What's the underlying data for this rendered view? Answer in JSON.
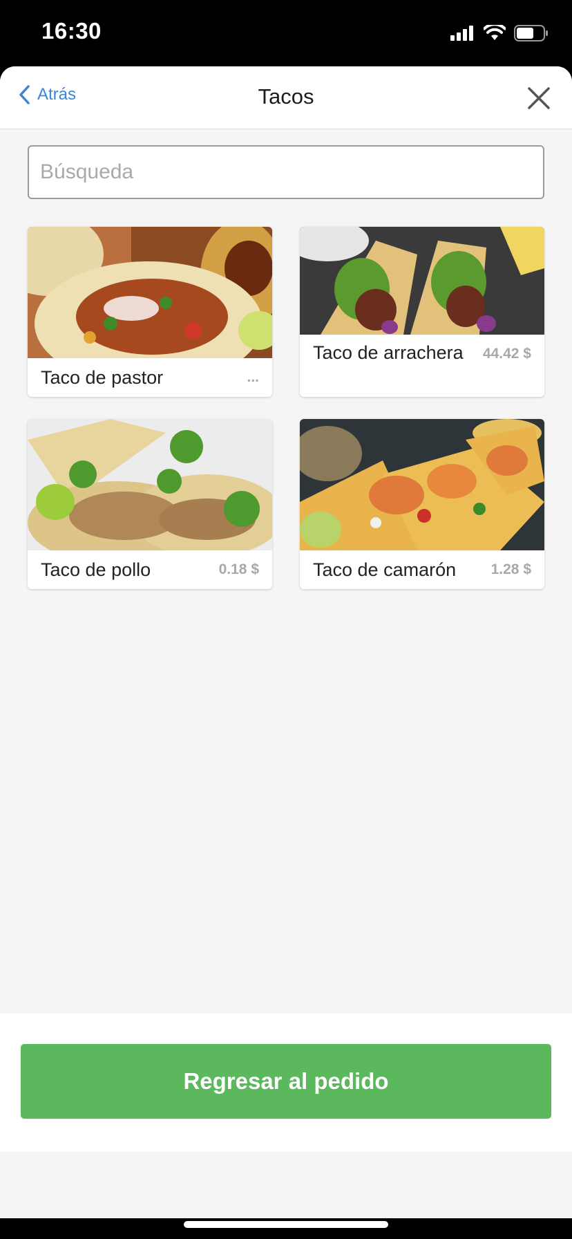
{
  "status_bar": {
    "time": "16:30"
  },
  "nav": {
    "back_label": "Atrás",
    "title": "Tacos"
  },
  "search": {
    "placeholder": "Búsqueda",
    "value": ""
  },
  "products": [
    {
      "name": "Taco de pastor",
      "price": "..."
    },
    {
      "name": "Taco de arrachera",
      "price": "44.42 $"
    },
    {
      "name": "Taco de pollo",
      "price": "0.18 $"
    },
    {
      "name": "Taco de camarón",
      "price": "1.28 $"
    }
  ],
  "footer": {
    "return_label": "Regresar al pedido"
  },
  "colors": {
    "accent_blue": "#3d86d6",
    "button_green": "#5cb85c",
    "price_gray": "#a8a8a8"
  }
}
